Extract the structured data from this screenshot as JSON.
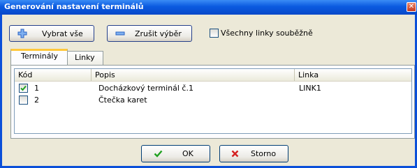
{
  "window": {
    "title": "Generování nastavení terminálů"
  },
  "toolbar": {
    "select_all_label": "Vybrat vše",
    "deselect_label": "Zrušit výběr",
    "all_lines_label": "Všechny linky souběžně",
    "all_lines_checked": false
  },
  "tabs": [
    {
      "label": "Terminály",
      "active": true
    },
    {
      "label": "Linky",
      "active": false
    }
  ],
  "table": {
    "columns": [
      "Kód",
      "Popis",
      "Linka"
    ],
    "rows": [
      {
        "checked": true,
        "kod": "1",
        "popis": "Docházkový terminál č.1",
        "linka": "LINK1"
      },
      {
        "checked": false,
        "kod": "2",
        "popis": "Čtečka karet",
        "linka": ""
      }
    ]
  },
  "footer": {
    "ok_label": "OK",
    "cancel_label": "Storno"
  },
  "colors": {
    "titlebar": "#0a5ae0",
    "check": "#21a121",
    "cancel_x": "#d42020",
    "tab_highlight": "#ffc83c"
  }
}
